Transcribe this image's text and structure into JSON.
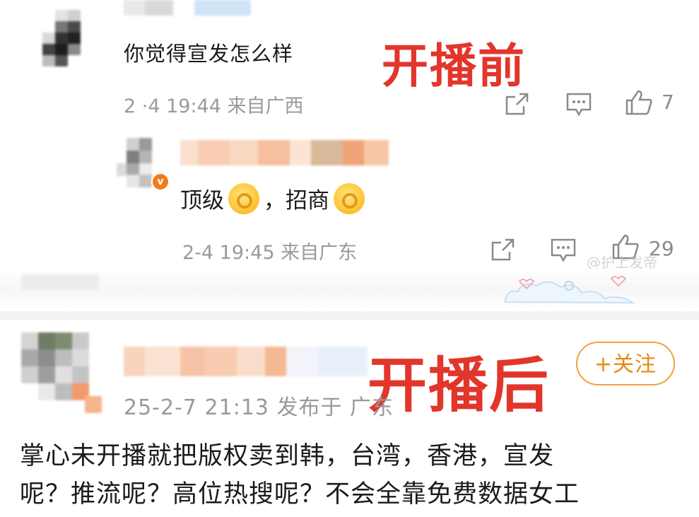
{
  "comment1": {
    "text": "你觉得宣发怎么样",
    "meta": "2 ·4 19:44 来自广西",
    "like_count": "7"
  },
  "label_before": "开播前",
  "reply": {
    "text_part1": "顶级",
    "text_part2": "，招商",
    "meta": "2-4 19:45 来自广东",
    "like_count": "29"
  },
  "watermark": "@护上发帝",
  "label_after": "开播后",
  "post": {
    "follow_label": "+关注",
    "meta": "25-2-7 21:13 发布于 广东",
    "body_lines": [
      "掌心未开播就把版权卖到韩，台湾，香港，宣发",
      "呢？推流呢？高位热搜呢？不会全靠免费数据女工"
    ]
  },
  "colors": {
    "label_red": "#e2362b",
    "follow_orange": "#e48a16",
    "meta_gray": "#9a9a9a",
    "verified_badge": "#f07b1e"
  },
  "icons": [
    "share-icon",
    "comment-icon",
    "like-icon",
    "verified-badge-icon",
    "ok-hand-emoji"
  ]
}
